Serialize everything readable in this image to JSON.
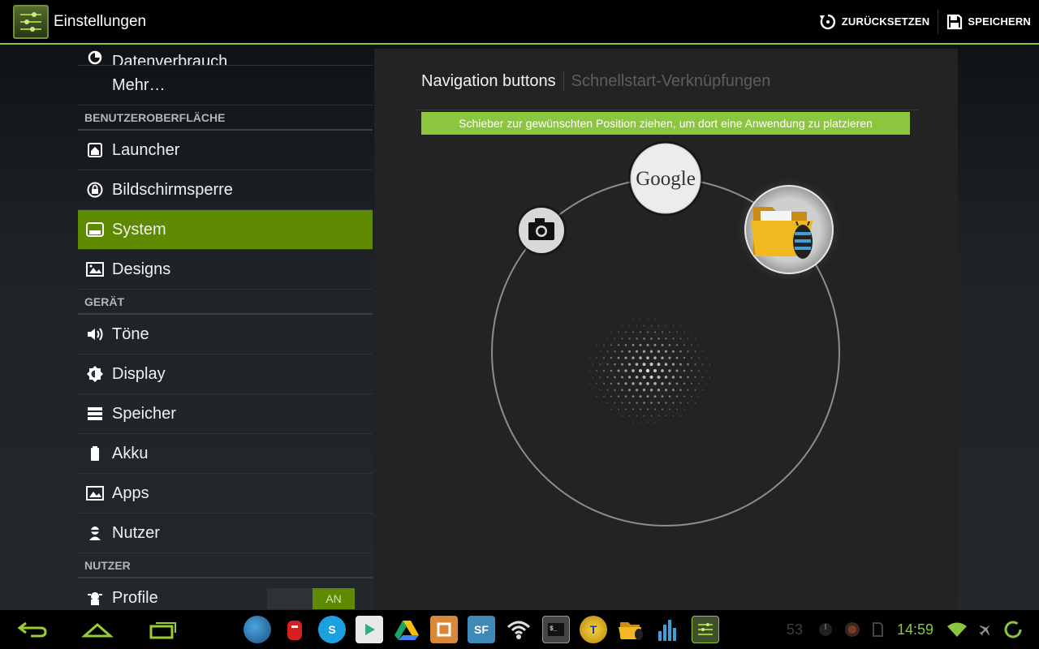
{
  "actionbar": {
    "title": "Einstellungen",
    "reset_label": "ZURÜCKSETZEN",
    "save_label": "SPEICHERN",
    "accent": "#8cc63f"
  },
  "settings": {
    "top_partial": "Datenverbrauch",
    "more": "Mehr…",
    "section_ui": "BENUTZEROBERFLÄCHE",
    "launcher": "Launcher",
    "lockscreen": "Bildschirmsperre",
    "system": "System",
    "designs": "Designs",
    "section_device": "GERÄT",
    "sound": "Töne",
    "display": "Display",
    "storage": "Speicher",
    "battery": "Akku",
    "apps": "Apps",
    "users": "Nutzer",
    "section_user": "NUTZER",
    "profiles": "Profile",
    "profiles_toggle": "AN",
    "selected_color": "#5d8a00"
  },
  "detail": {
    "tab_nav": "Navigation buttons",
    "tab_quick": "Schnellstart-Verknüpfungen",
    "hint": "Schieber zur gewünschten Position ziehen, um dort eine Anwendung zu platzieren",
    "google_label": "Google",
    "targets": [
      "camera-icon",
      "google-search-icon",
      "file-manager-icon"
    ]
  },
  "sysbar": {
    "nav": [
      "back-icon",
      "home-icon",
      "recents-icon"
    ],
    "apps": [
      "globe-app-icon",
      "mailbox-app-icon",
      "skype-app-icon",
      "play-store-app-icon",
      "drive-app-icon",
      "orange-app-icon",
      "sf-app-icon",
      "wifi-analyzer-app-icon",
      "terminal-app-icon",
      "titanium-app-icon",
      "file-manager-app-icon",
      "equalizer-app-icon",
      "settings-app-icon"
    ],
    "sf_text": "SF",
    "titanium_text": "T",
    "notification_count": "53",
    "clock": "14:59"
  }
}
